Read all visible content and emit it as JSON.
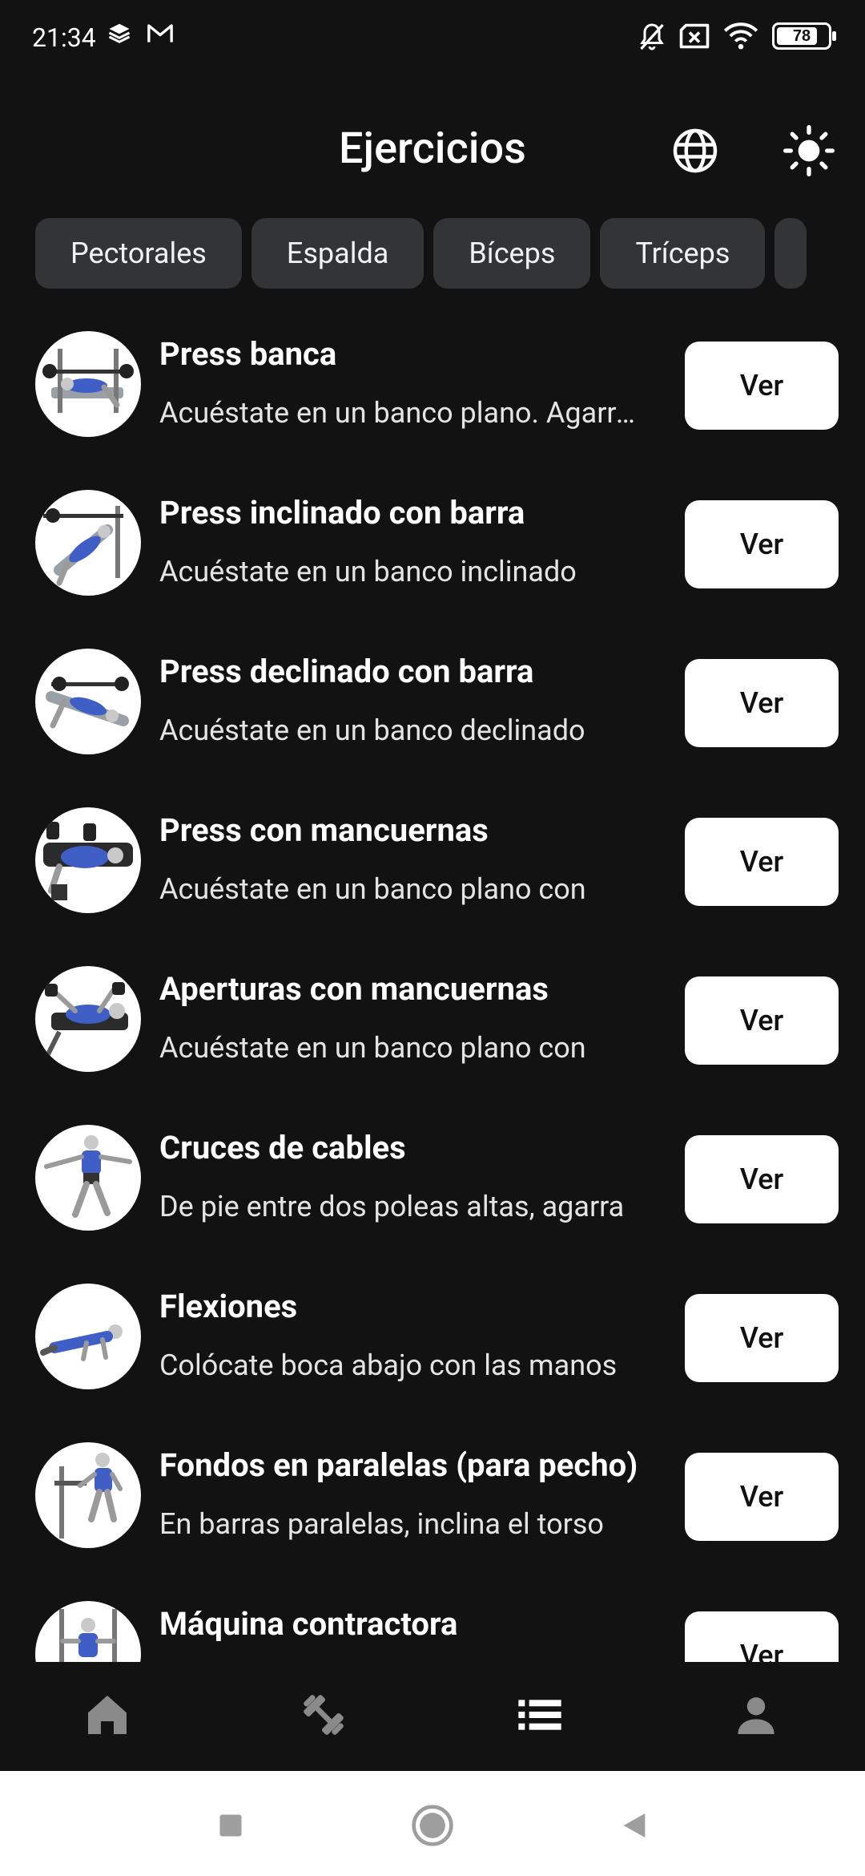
{
  "status_bar": {
    "time": "21:34",
    "battery": "78",
    "left_icons": [
      "layers-icon",
      "gmail-icon"
    ],
    "right_icons": [
      "bell-off-icon",
      "sim-x-icon",
      "wifi-icon",
      "battery-icon"
    ]
  },
  "header": {
    "title": "Ejercicios",
    "icons": [
      "globe-icon",
      "sun-icon"
    ]
  },
  "categories": [
    "Pectorales",
    "Espalda",
    "Bíceps",
    "Tríceps"
  ],
  "exercises": [
    {
      "title": "Press banca",
      "desc": "Acuéstate en un banco plano. Agarra la barra",
      "button": "Ver"
    },
    {
      "title": "Press inclinado con barra",
      "desc": "Acuéstate en un banco inclinado",
      "button": "Ver"
    },
    {
      "title": "Press declinado con barra",
      "desc": "Acuéstate en un banco declinado",
      "button": "Ver"
    },
    {
      "title": "Press con mancuernas",
      "desc": "Acuéstate en un banco plano con",
      "button": "Ver"
    },
    {
      "title": "Aperturas con mancuernas",
      "desc": "Acuéstate en un banco plano con",
      "button": "Ver"
    },
    {
      "title": "Cruces de cables",
      "desc": "De pie entre dos poleas altas, agarra",
      "button": "Ver"
    },
    {
      "title": "Flexiones",
      "desc": "Colócate boca abajo con las manos",
      "button": "Ver"
    },
    {
      "title": "Fondos en paralelas (para pecho)",
      "desc": "En barras paralelas, inclina el torso",
      "button": "Ver"
    },
    {
      "title": "Máquina contractora",
      "desc": "",
      "button": "Ver"
    }
  ],
  "bottom_nav": [
    {
      "icon": "home-icon",
      "active": false
    },
    {
      "icon": "dumbbell-icon",
      "active": false
    },
    {
      "icon": "list-icon",
      "active": true
    },
    {
      "icon": "person-icon",
      "active": false
    }
  ],
  "system_nav": [
    "recents-icon",
    "home-circle-icon",
    "back-icon"
  ],
  "colors": {
    "background": "#121212",
    "chip": "#333436",
    "button": "#ffffff",
    "nav_inactive": "#8a8a8a",
    "nav_active": "#ffffff"
  }
}
